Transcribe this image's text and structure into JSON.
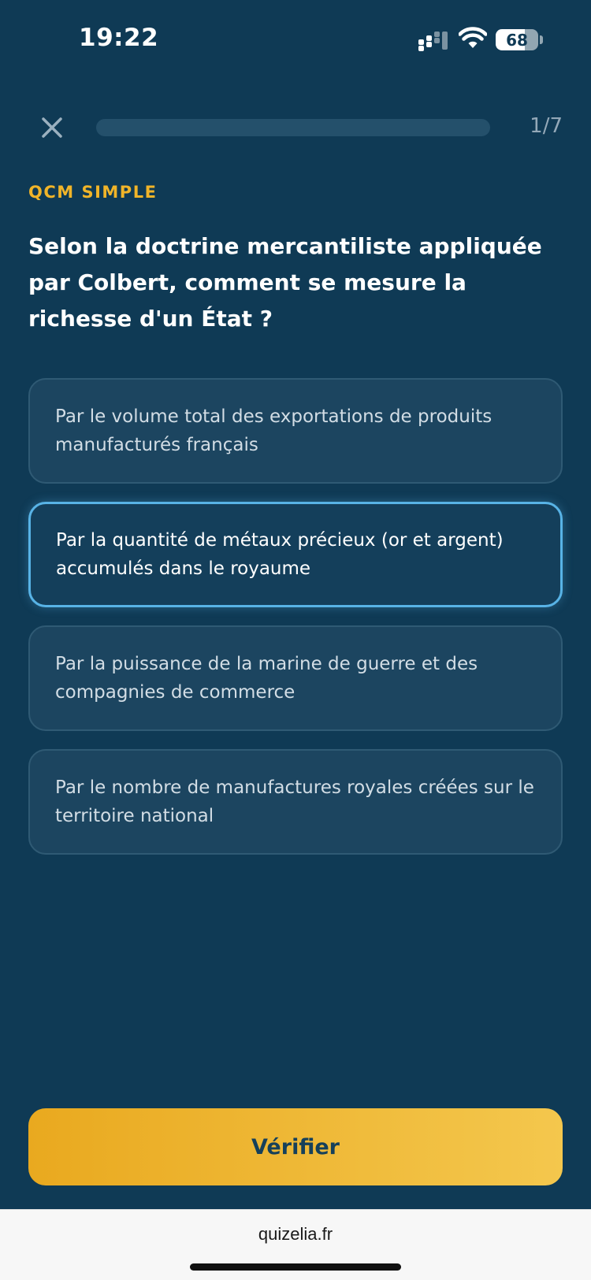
{
  "status_bar": {
    "time": "19:22",
    "battery_level": 68,
    "battery_text": "68"
  },
  "quiz": {
    "progress_counter": "1/7",
    "progress_fraction": 0.0,
    "question_type": "QCM SIMPLE",
    "question": "Selon la doctrine mercantiliste appliquée par Colbert, comment se mesure la richesse d'un État ?",
    "options": [
      {
        "label": "Par le volume total des exportations de produits manufacturés français",
        "selected": false
      },
      {
        "label": "Par la quantité de métaux précieux (or et argent) accumulés dans le royaume",
        "selected": true
      },
      {
        "label": "Par la puissance de la marine de guerre et des compagnies de commerce",
        "selected": false
      },
      {
        "label": "Par le nombre de manufactures royales créées sur le territoire national",
        "selected": false
      }
    ],
    "verify_label": "Vérifier"
  },
  "browser": {
    "url": "quizelia.fr"
  },
  "colors": {
    "background": "#0f3a55",
    "accent": "#f0b429",
    "selected_border": "#58b3e6"
  }
}
